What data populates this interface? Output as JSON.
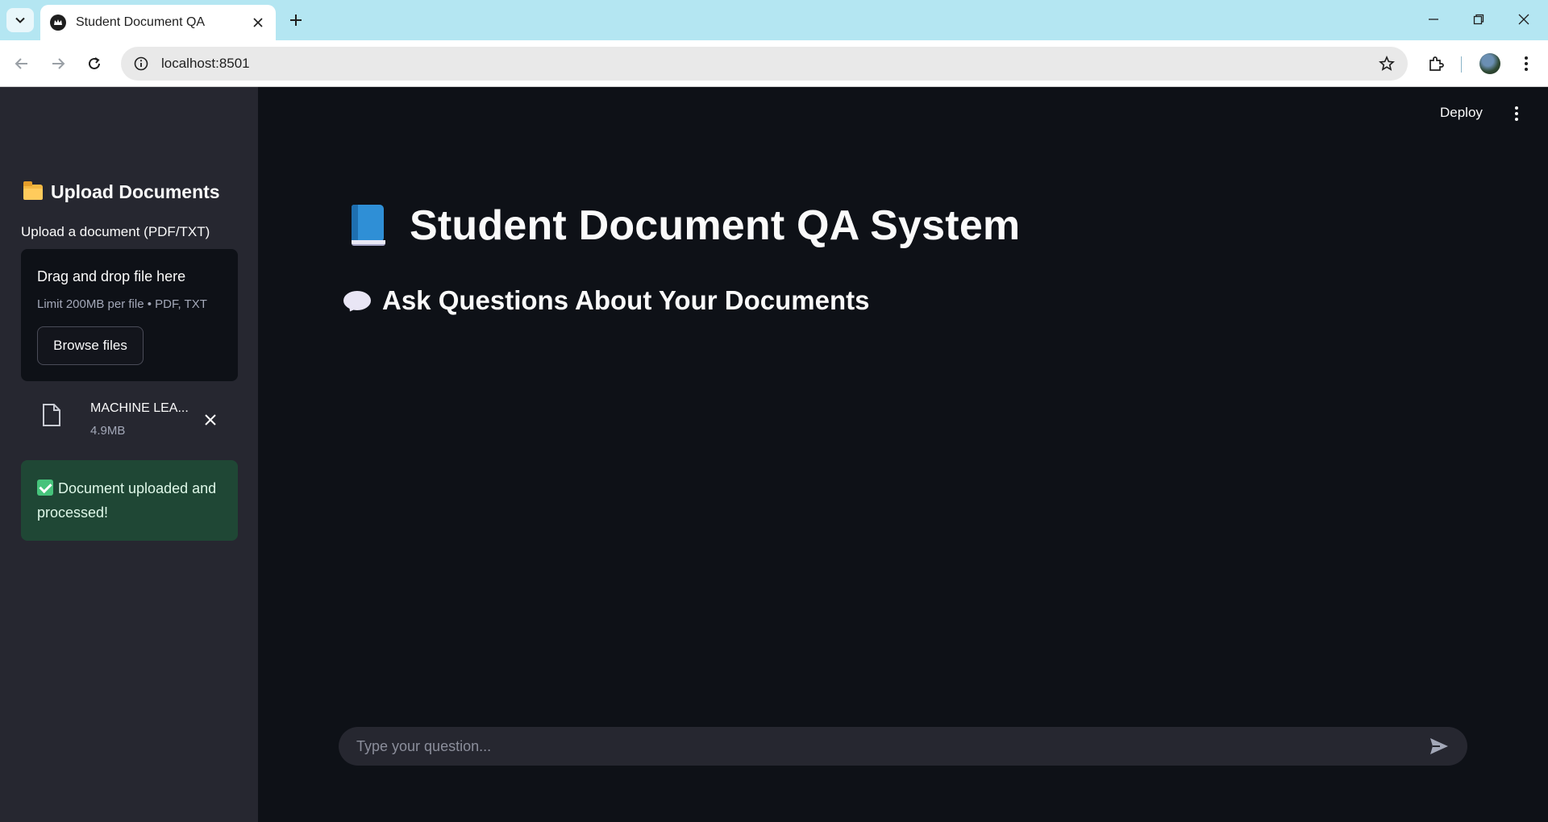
{
  "browser": {
    "tab_title": "Student Document QA",
    "url": "localhost:8501"
  },
  "app_header": {
    "deploy_label": "Deploy"
  },
  "sidebar": {
    "header": "Upload Documents",
    "uploader_label": "Upload a document (PDF/TXT)",
    "dropzone_title": "Drag and drop file here",
    "dropzone_limit": "Limit 200MB per file • PDF, TXT",
    "browse_label": "Browse files",
    "file": {
      "name": "MACHINE LEA...",
      "size": "4.9MB"
    },
    "success_message": "Document uploaded and processed!"
  },
  "main": {
    "title": "Student Document QA System",
    "subtitle": "Ask Questions About Your Documents",
    "chat_placeholder": "Type your question..."
  },
  "icons": {
    "title_emoji": "blue-book-icon",
    "subtitle_emoji": "speech-bubble-icon",
    "sidebar_emoji": "folder-icon",
    "success_emoji": "check-mark-icon"
  },
  "colors": {
    "app_background": "#0e1117",
    "sidebar_background": "#262730",
    "success_background": "#1f4735",
    "tab_strip": "#b4e6f2"
  }
}
